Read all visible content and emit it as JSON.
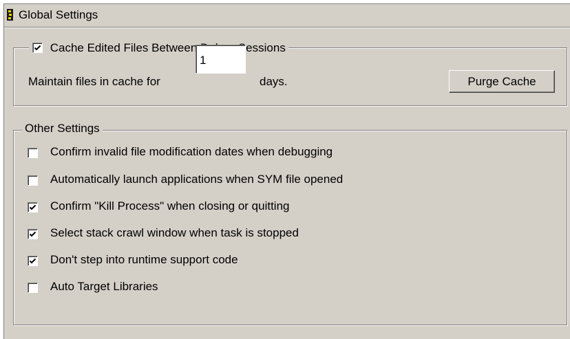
{
  "window": {
    "title": "Global Settings",
    "icon": "settings-panel-icon"
  },
  "cache_group": {
    "legend_label": "Cache Edited Files Between Debug Sessions",
    "legend_checked": true,
    "maintain_label": "Maintain files in cache for",
    "days_value": "1",
    "days_label": "days.",
    "purge_button": "Purge Cache"
  },
  "other_group": {
    "legend": "Other Settings",
    "options": [
      {
        "label": "Confirm invalid file modification dates when debugging",
        "checked": false
      },
      {
        "label": "Automatically launch applications when SYM file opened",
        "checked": false
      },
      {
        "label": "Confirm \"Kill Process\" when closing or quitting",
        "checked": true
      },
      {
        "label": "Select stack crawl window when task is stopped",
        "checked": true
      },
      {
        "label": "Don't step into runtime support code",
        "checked": true
      },
      {
        "label": "Auto Target Libraries",
        "checked": false
      }
    ]
  }
}
